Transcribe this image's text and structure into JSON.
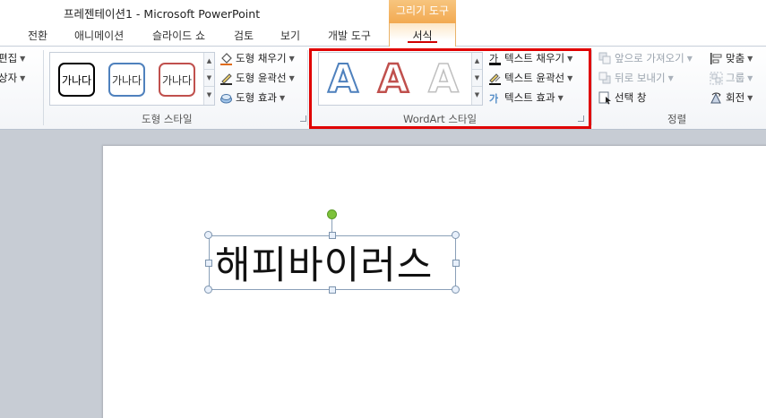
{
  "window": {
    "title": "프레젠테이션1 - Microsoft PowerPoint",
    "context_header": "그리기 도구"
  },
  "tabs": [
    {
      "label": "전환"
    },
    {
      "label": "애니메이션"
    },
    {
      "label": "슬라이드 쇼"
    },
    {
      "label": "검토"
    },
    {
      "label": "보기"
    },
    {
      "label": "개발 도구"
    }
  ],
  "active_tab": "서식",
  "ribbon": {
    "left_partial": {
      "edit_label": "편집",
      "textbox_label": "상자"
    },
    "shape_styles": {
      "group_label": "도형 스타일",
      "swatches": [
        {
          "text": "가나다",
          "color": "#000000"
        },
        {
          "text": "가나다",
          "color": "#4f81bd"
        },
        {
          "text": "가나다",
          "color": "#c0504d"
        }
      ],
      "fill": "도형 채우기",
      "outline": "도형 윤곽선",
      "effects": "도형 효과"
    },
    "wordart": {
      "group_label": "WordArt 스타일",
      "letters": [
        {
          "text": "A",
          "color": "#4f81bd"
        },
        {
          "text": "A",
          "color": "#c0504d"
        },
        {
          "text": "A",
          "color": "#bfbfbf"
        }
      ],
      "text_fill": "텍스트 채우기",
      "text_outline": "텍스트 윤곽선",
      "text_effects": "텍스트 효과"
    },
    "arrange": {
      "group_label": "정렬",
      "bring_forward": "앞으로 가져오기",
      "send_backward": "뒤로 보내기",
      "selection_pane": "선택 창",
      "align": "맞춤",
      "group": "그룹",
      "rotate": "회전"
    }
  },
  "document": {
    "textbox_text": "해피바이러스"
  },
  "colors": {
    "context_accent": "#f2a951",
    "highlight": "#e00000"
  }
}
